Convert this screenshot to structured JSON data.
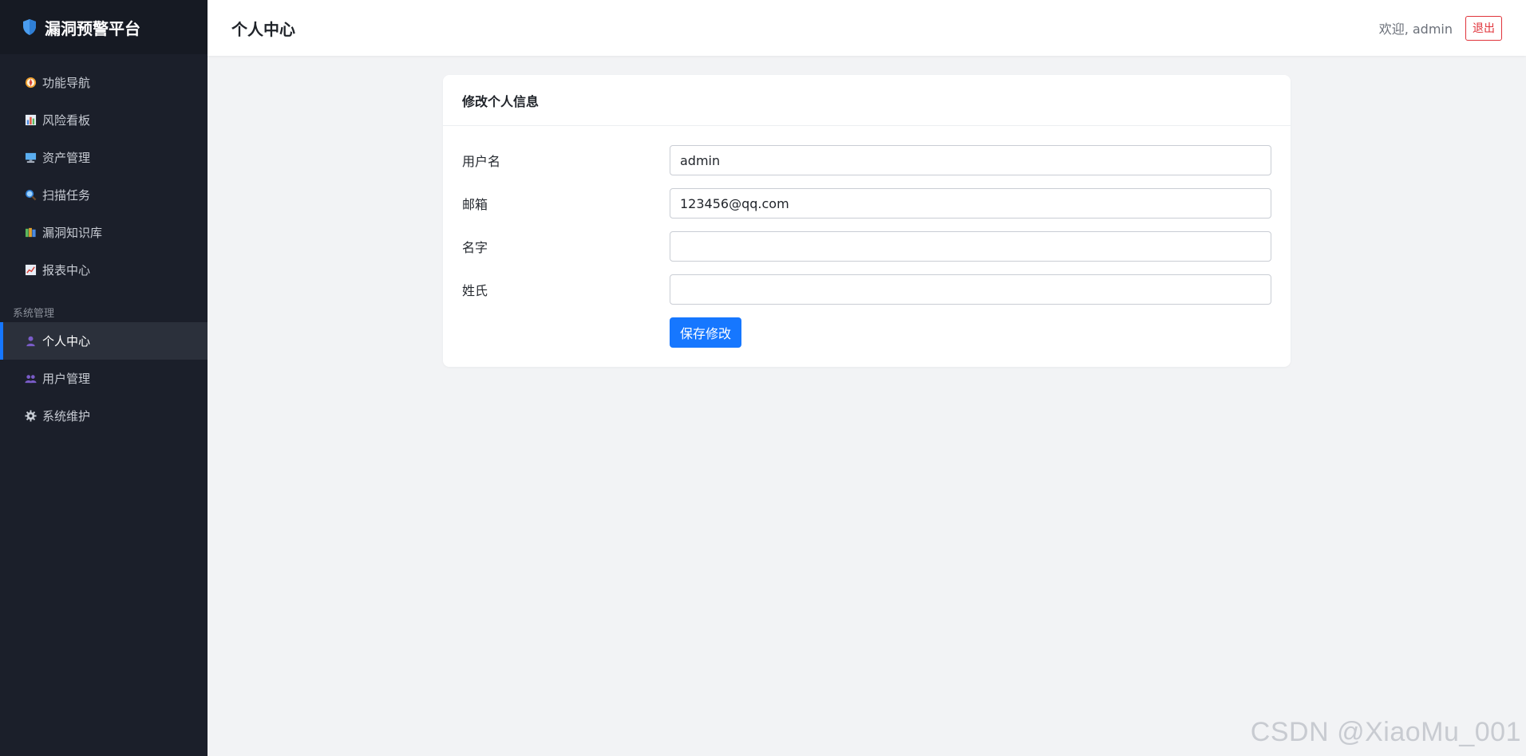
{
  "sidebar": {
    "brand_title": "漏洞预警平台",
    "items": [
      {
        "label": "功能导航",
        "icon": "compass-icon"
      },
      {
        "label": "风险看板",
        "icon": "bar-chart-icon"
      },
      {
        "label": "资产管理",
        "icon": "monitor-icon"
      },
      {
        "label": "扫描任务",
        "icon": "magnifier-icon"
      },
      {
        "label": "漏洞知识库",
        "icon": "books-icon"
      },
      {
        "label": "报表中心",
        "icon": "trend-chart-icon"
      }
    ],
    "section_title": "系统管理",
    "system_items": [
      {
        "label": "个人中心",
        "icon": "user-icon",
        "active": true
      },
      {
        "label": "用户管理",
        "icon": "users-icon"
      },
      {
        "label": "系统维护",
        "icon": "gear-icon"
      }
    ]
  },
  "header": {
    "title": "个人中心",
    "welcome": "欢迎, admin",
    "logout_label": "退出"
  },
  "card": {
    "title": "修改个人信息",
    "fields": [
      {
        "label": "用户名",
        "value": "admin"
      },
      {
        "label": "邮箱",
        "value": "123456@qq.com"
      },
      {
        "label": "名字",
        "value": ""
      },
      {
        "label": "姓氏",
        "value": ""
      }
    ],
    "save_label": "保存修改"
  },
  "watermark": "CSDN @XiaoMu_001",
  "colors": {
    "sidebar_bg": "#1b1f2a",
    "accent": "#1677ff",
    "danger": "#e0333a",
    "page_bg": "#f2f3f5"
  }
}
